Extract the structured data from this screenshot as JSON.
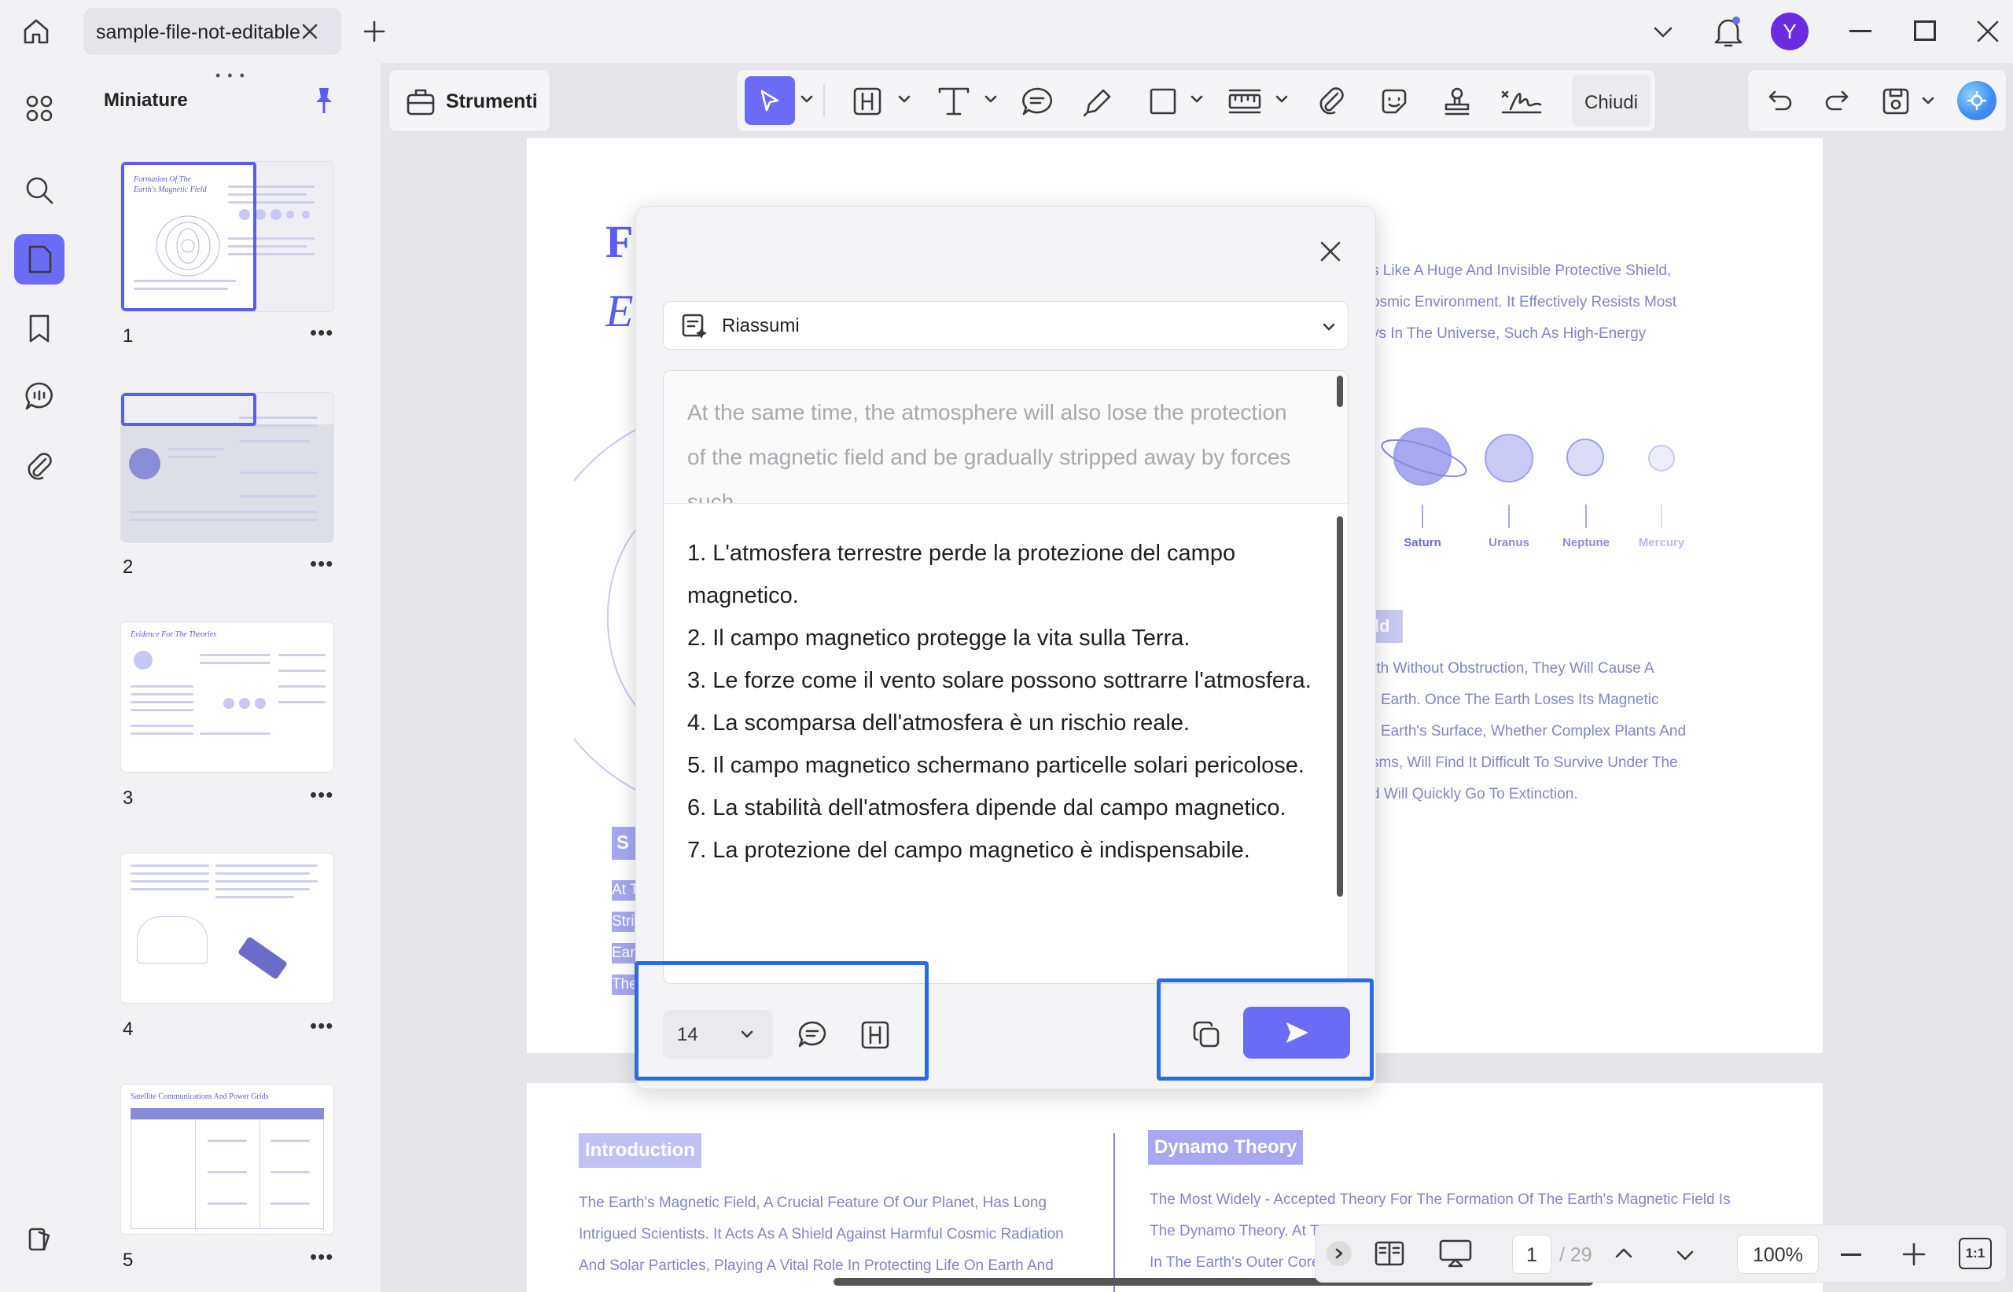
{
  "window": {
    "tab_title": "sample-file-not-editable",
    "avatar_initial": "Y"
  },
  "toolbar": {
    "tools_label": "Strumenti",
    "close_label": "Chiudi"
  },
  "sidebar": {
    "title": "Miniature",
    "pages": [
      "1",
      "2",
      "3",
      "4",
      "5"
    ]
  },
  "thumb_titles": {
    "p1": "Formation Of The Earth's Magnetic Field",
    "p3": "Evidence For The Theories",
    "p5": "Satellite Communications And Power Grids"
  },
  "document": {
    "page1_heading_a": "F",
    "page1_heading_b": "E",
    "right_text_top": [
      "s Like A Huge And Invisible Protective Shield,",
      "osmic Environment. It Effectively Resists Most",
      "ys In The Universe, Such As High-Energy"
    ],
    "planets": [
      "Saturn",
      "Uranus",
      "Neptune",
      "Mercury"
    ],
    "right_tag": "ld",
    "right_text_mid": [
      "rth Without Obstruction, They Will Cause A",
      "Earth. Once The Earth Loses Its Magnetic",
      "Earth's Surface, Whether Complex Plants And",
      "sms, Will Find It Difficult To Survive Under The",
      "d Will Quickly Go To Extinction."
    ],
    "left_tag": "S",
    "left_fragments": [
      "At T",
      "Stri",
      "Ear",
      "The"
    ],
    "intro_title": "Introduction",
    "intro_text": [
      "The Earth's Magnetic Field, A Crucial Feature Of Our Planet, Has Long",
      "Intrigued Scientists. It Acts As A Shield Against Harmful Cosmic Radiation",
      "And Solar Particles, Playing A Vital Role In Protecting Life On Earth And"
    ],
    "dynamo_title": "Dynamo Theory",
    "dynamo_text": [
      "The Most Widely - Accepted Theory For The Formation Of The Earth's Magnetic Field Is",
      "The Dynamo Theory. At The",
      "In The Earth's Outer Core"
    ]
  },
  "dialog": {
    "mode": "Riassumi",
    "source_text": "At the same time, the atmosphere will also lose the protection of the magnetic field and be gradually stripped away by forces such",
    "result": [
      "1. L'atmosfera terrestre perde la protezione del campo magnetico.",
      "2. Il campo magnetico protegge la vita sulla Terra.",
      "3. Le forze come il vento solare possono sottrarre l'atmosfera.",
      "4. La scomparsa dell'atmosfera è un rischio reale.",
      "5. Il campo magnetico schermano particelle solari pericolose.",
      "6. La stabilità dell'atmosfera dipende dal campo magnetico.",
      "7. La protezione del campo magnetico è indispensabile."
    ],
    "font_size": "14"
  },
  "pagenav": {
    "current": "1",
    "total": "/ 29",
    "zoom": "100%",
    "fit": "1:1"
  },
  "colors": {
    "accent": "#6a6cf6",
    "highlight": "#2a6be4"
  }
}
